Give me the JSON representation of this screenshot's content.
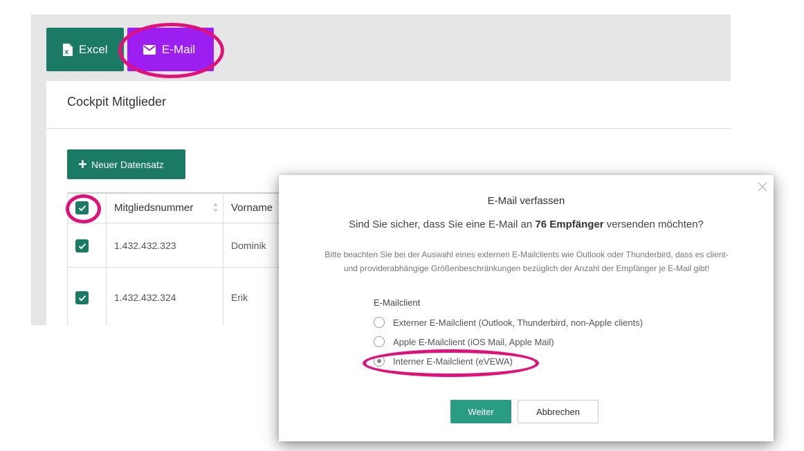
{
  "toolbar": {
    "excel_label": "Excel",
    "email_label": "E-Mail"
  },
  "card": {
    "title": "Cockpit Mitglieder",
    "new_record_label": "Neuer Datensatz"
  },
  "table": {
    "columns": [
      "Mitgliedsnummer",
      "Vorname"
    ],
    "rows": [
      {
        "checked": true,
        "number": "1.432.432.323",
        "firstname": "Dominik"
      },
      {
        "checked": true,
        "number": "1.432.432.324",
        "firstname": "Erik"
      }
    ]
  },
  "dialog": {
    "title": "E-Mail verfassen",
    "question_prefix": "Sind Sie sicher, dass Sie eine E-Mail an",
    "question_count": "76 Empfänger",
    "question_suffix": "versenden möchten?",
    "note_line1": "Bitte beachten Sie bei der Auswahl eines externen E-Mailclients wie Outlook oder Thunderbird, dass es client-",
    "note_line2": "und providerabhängige Größenbeschränkungen bezüglich der Anzahl der Empfänger je E-Mail gibt!",
    "client_label": "E-Mailclient",
    "options": [
      {
        "label": "Externer E-Mailclient (Outlook, Thunderbird, non-Apple clients)",
        "selected": false
      },
      {
        "label": "Apple E-Mailclient (iOS Mail, Apple Mail)",
        "selected": false
      },
      {
        "label": "Interner E-Mailclient (eVEWA)",
        "selected": true
      }
    ],
    "continue_label": "Weiter",
    "cancel_label": "Abbrechen"
  },
  "colors": {
    "primary_green": "#1a7a63",
    "email_purple": "#9c1ef0",
    "annotation_pink": "#e0127a",
    "dialog_button_green": "#2a9c83"
  },
  "icons": [
    "excel-file-icon",
    "envelope-icon",
    "plus-icon",
    "check-icon",
    "sort-icon",
    "close-icon"
  ]
}
